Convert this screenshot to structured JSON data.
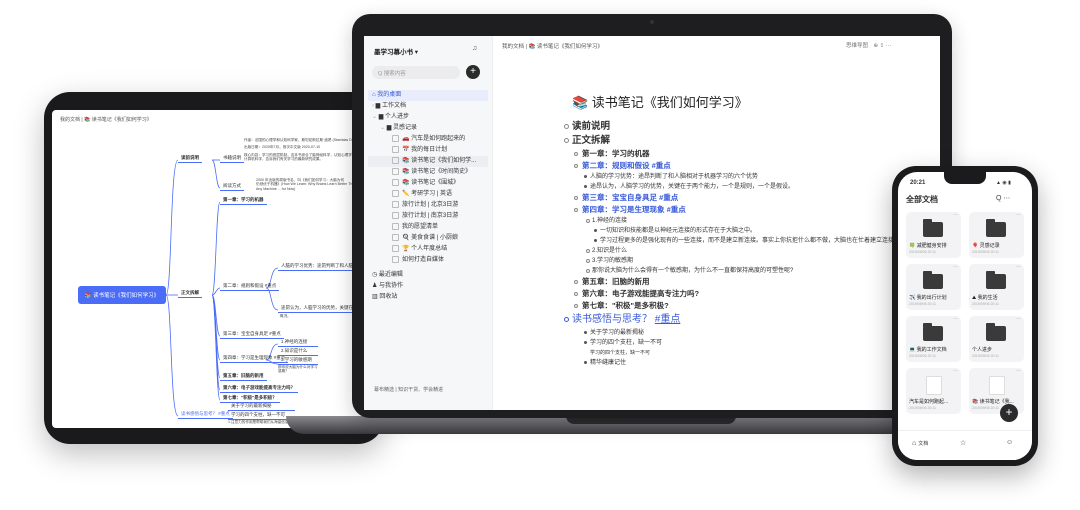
{
  "tablet": {
    "breadcrumb": "我的文档 | 📚 读书笔记《我们如何学习》",
    "mindmap": {
      "root": "📚 读书笔记《我们如何学习》",
      "branches": [
        "读前说明",
        "正文拆解",
        "读书感悟与思考？ #重点"
      ],
      "sub_reading": [
        "书籍说明",
        "阅读方式"
      ],
      "sub_reading_leaves": [
        "作者：法国的心理学和认知科学家，斯坦尼斯拉斯·迪昂 (Stanislas Dehaene)",
        "出版日期：2020年7月，首次中文版 2020-07-10",
        "核心内容：学习的底层机制，这本书综合了脑神经科学，认知心理学及人工智能",
        "计算机科学，告诉我们有关学习的最新研究成果。",
        "2000 年出版的原版书名，叫《我们如何学习：大脑为何",
        "仍然优于机器》(How We Learn: Why Brains Learn Better Than",
        "Any Machine ... for Now)"
      ],
      "chapters": [
        "第一章：学习的机器",
        "第二章：规则和假设 #重点",
        "第三章：宝宝自身具足 #重点",
        "第四章：学习是生理现象 #重点",
        "第五章：旧脑的新用",
        "第六章：电子游戏能提高专注力吗？",
        "第七章：\"积极\"是多积极？"
      ],
      "ch2_leaves": [
        "人脑的学习优势：途昂判断了和人脑相对于机器学习的",
        "途昂认为，人脑学习的优势，关键在于两个能力",
        "概况。"
      ],
      "ch4_leaves": [
        "1.神经的连接",
        "2.知识是什么",
        "3.学习的敏感期",
        "那你说大脑为什么对学习",
        "感期？"
      ],
      "thoughts_leaves": [
        "关于学习的最新揭秘",
        "学习的四个支柱，缺一不可",
        "1.注意力的作用是帮助我们从海量信息中..."
      ]
    }
  },
  "laptop": {
    "sidebar": {
      "title": "墨学习幕小书 ▾",
      "search_placeholder": "Q 搜索内容",
      "items": [
        {
          "label": "我的桌面",
          "icon": "home-icon"
        },
        {
          "label": "工作文档",
          "icon": "folder-icon"
        },
        {
          "label": "个人进步",
          "icon": "folder-icon"
        },
        {
          "label": "灵感记录",
          "icon": "folder-icon"
        },
        {
          "label": "🚗 汽车是如何跑起来的",
          "icon": "doc-icon"
        },
        {
          "label": "📅 我的每日计划",
          "icon": "doc-icon"
        },
        {
          "label": "📚 读书笔记《我们如何学...",
          "icon": "doc-icon"
        },
        {
          "label": "📚 读书笔记《时间简史》",
          "icon": "doc-icon"
        },
        {
          "label": "📚 读书笔记《围城》",
          "icon": "doc-icon"
        },
        {
          "label": "✏️ 考研学习 | 英语",
          "icon": "doc-icon"
        },
        {
          "label": "旅行计划 | 北京3日游",
          "icon": "doc-icon"
        },
        {
          "label": "旅行计划 | 南京3日游",
          "icon": "doc-icon"
        },
        {
          "label": "我的愿望清单",
          "icon": "doc-icon"
        },
        {
          "label": "🍳 美食食谱 | 小厨娘",
          "icon": "doc-icon"
        },
        {
          "label": "🏆 个人年度总结",
          "icon": "doc-icon"
        },
        {
          "label": "如何打造自媒体",
          "icon": "doc-icon"
        }
      ],
      "bottom_items": [
        "最近编辑",
        "与我协作",
        "回收站"
      ],
      "footer": "幕布精选 | 知识干货、学会精进"
    },
    "breadcrumb": "我的文档 | 📚 读书笔记《我们如何学习》",
    "toolbar": {
      "mindmap": "思维导图",
      "icons": "⊕  ⇪  ⋯"
    },
    "doc_title": "📚 读书笔记《我们如何学习》",
    "outline": {
      "h_reading": "读前说明",
      "h_body": "正文拆解",
      "ch1": "第一章：学习的机器",
      "ch2": "第二章：规则和假设",
      "ch2_tag": "#重点",
      "ch2_t1": "人脑的学习优势：途昂判断了和人脑相对于机器学习的六个优势",
      "ch2_t2": "途昂认为，人脑学习的优势，关键在于两个能力，一个是规则，一个是假设。",
      "ch3": "第三章：宝宝自身具足",
      "ch3_tag": "#重点",
      "ch4": "第四章：学习是生理现象",
      "ch4_tag": "#重点",
      "ch4_s1": "1.神经的连接",
      "ch4_s1_a": "一切知识和技能都是以神经元连接的形式存在于大脑之中。",
      "ch4_s1_b": "学习过程更多的是强化现有的一些连接，而不是建立新连接。事实上你抗拒什么都不做，大脑也在忙着建立连接。",
      "ch4_s2": "2.知识是什么",
      "ch4_s3": "3.学习的敏感期",
      "ch4_s4": "那你说大脑为什么会得有一个敏感期，为什么不一直都保持高度的可塑性呢?",
      "ch5": "第五章：旧脑的新用",
      "ch6": "第六章：电子游戏能提高专注力吗?",
      "ch7": "第七章：\"积极\"是多积极?",
      "h_thoughts": "读书感悟与思考？",
      "h_thoughts_tag": "#重点",
      "th1": "关于学习的最新揭秘",
      "th2": "学习的四个支柱，缺一不可",
      "th2_note": "学习的四个支柱，缺一不可",
      "th3": "精华缝康记住"
    }
  },
  "phone": {
    "time": "20:21",
    "status": "▲ ◉ ▮",
    "title": "全部文档",
    "header_icons": "Q  ⋯",
    "cards": [
      {
        "name": "🍀 减肥健身安排",
        "date": "2019/09/06 20:11",
        "type": "folder"
      },
      {
        "name": "🎈 灵感记录",
        "date": "2019/09/06 20:11",
        "type": "folder"
      },
      {
        "name": "✈️ 我的出行计划",
        "date": "2019/09/06 20:11",
        "type": "folder"
      },
      {
        "name": "⛰ 我的生活",
        "date": "2019/09/06 20:11",
        "type": "folder"
      },
      {
        "name": "💻 我的工作文档",
        "date": "2019/09/06 20:11",
        "type": "folder"
      },
      {
        "name": "个人进步",
        "date": "2019/09/06 20:11",
        "type": "folder"
      },
      {
        "name": "汽车是如何跑起...",
        "date": "2019/09/06 20:11",
        "type": "doc"
      },
      {
        "name": "📚 读书笔记《我...",
        "date": "2019/09/06 20:11",
        "type": "doc"
      }
    ],
    "nav": {
      "docs": "文档",
      "star": "☆",
      "me": "☺"
    },
    "fab": "+"
  },
  "colors": {
    "accent": "#3a5bd9",
    "root": "#4a6cf7",
    "device": "#1e1e20"
  }
}
